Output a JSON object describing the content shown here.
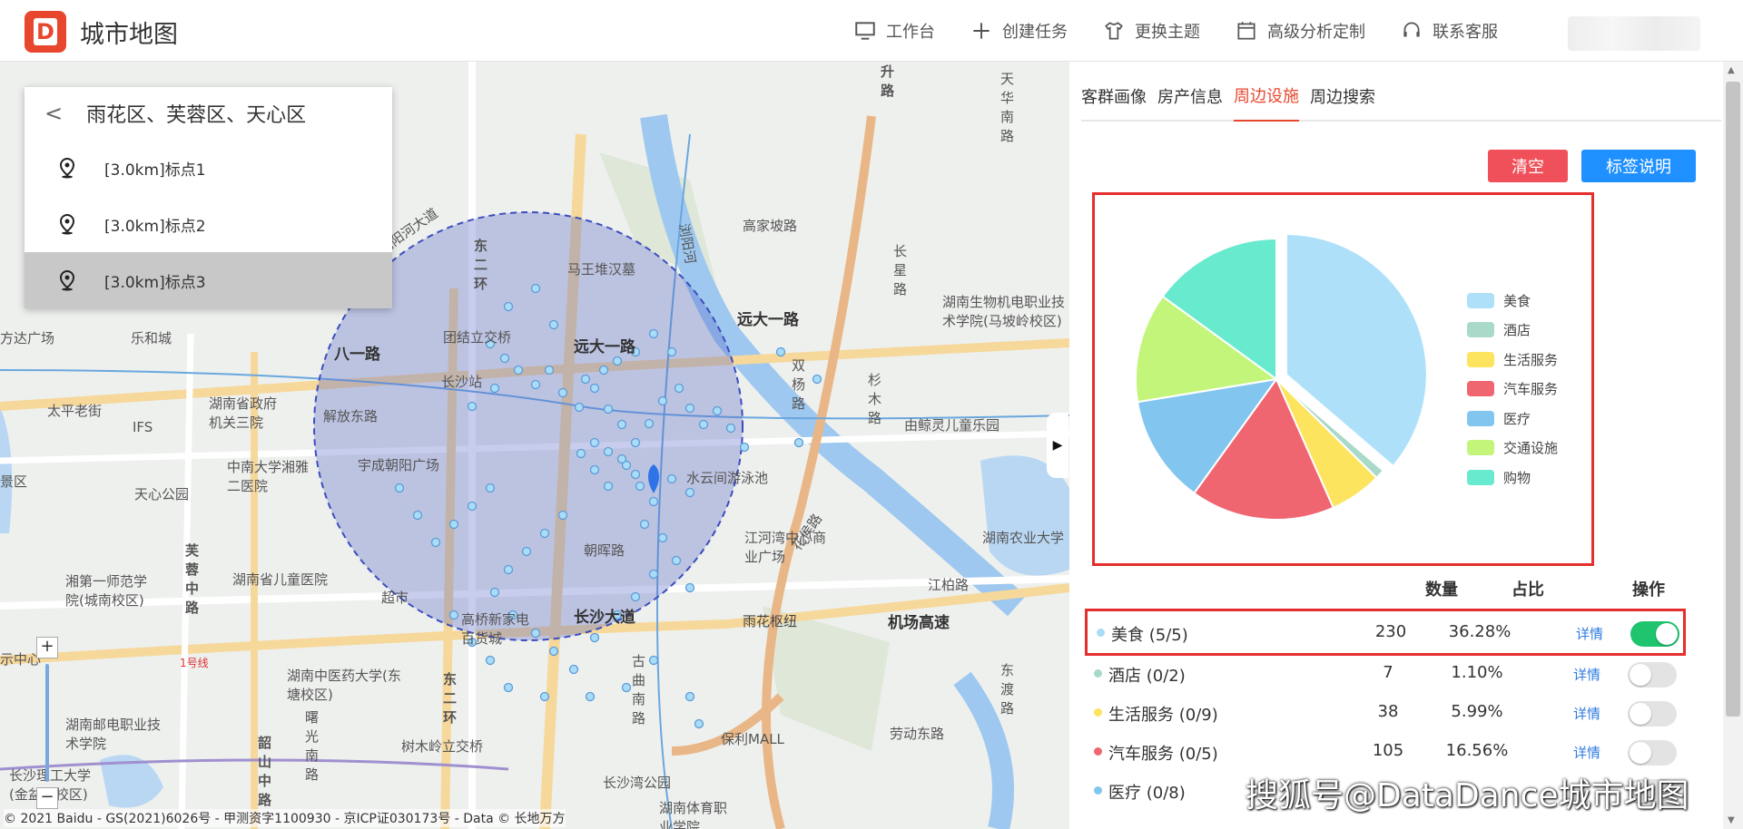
{
  "header": {
    "logo_text": "D",
    "title": "城市地图",
    "nav": [
      {
        "label": "工作台",
        "icon": "monitor-icon"
      },
      {
        "label": "创建任务",
        "icon": "plus-icon"
      },
      {
        "label": "更换主题",
        "icon": "shirt-icon"
      },
      {
        "label": "高级分析定制",
        "icon": "calendar-icon"
      },
      {
        "label": "联系客服",
        "icon": "headset-icon"
      }
    ]
  },
  "location_panel": {
    "title": "雨花区、芙蓉区、天心区",
    "items": [
      {
        "label": "[3.0km]标点1",
        "active": false
      },
      {
        "label": "[3.0km]标点2",
        "active": false
      },
      {
        "label": "[3.0km]标点3",
        "active": true
      }
    ]
  },
  "map": {
    "labels": {
      "l1": "马王堆汉墓",
      "l2": "远大一路",
      "l3": "远大一路",
      "l4": "团结立交桥",
      "l5": "长沙站",
      "l6": "八一路",
      "l7": "湖南省政府机关三院",
      "l8": "解放东路",
      "l9": "太平老街",
      "l10": "IFS",
      "l11": "中南大学湘雅二医院",
      "l12": "天心公园",
      "l13": "宇成朝阳广场",
      "l14": "水云间游泳池",
      "l15": "江河湾中心商业广场",
      "l16": "朝晖路",
      "l17": "长沙大道",
      "l18": "雨花枢纽",
      "l19": "机场高速",
      "l20": "高桥新家电百货城",
      "l21": "湖南省儿童医院",
      "l22": "湖南中医药大学(东塘校区)",
      "l23": "湖南邮电职业技术学院",
      "l24": "长沙理工大学(金盆岭校区)",
      "l25": "湖南生物机电职业技术学院(马坡岭校区)",
      "l26": "由鲸灵儿童乐园",
      "l27": "湖南农业大学",
      "l28": "高家坡路",
      "l29": "湘第一师范学院(城南校区)",
      "l30": "乐和城",
      "l31": "劳动东路",
      "l32": "树木岭立交桥",
      "l33": "保利MALL",
      "l34": "长沙湾公园",
      "l35": "湖南体育职业学院",
      "l36": "浏阳河大道",
      "l37": "东二环",
      "l38": "芙蓉中路",
      "l39": "韶山中路",
      "l40": "双杨路",
      "l41": "杉木路",
      "l42": "花侯路",
      "l43": "古曲南路",
      "l44": "曙光南路",
      "l45": "江柏路",
      "l46": "浏阳河",
      "l47": "超市",
      "l48": "长星路",
      "l49": "天华南路",
      "l50": "景区",
      "l51": "方达广场",
      "l52": "东二环",
      "l53": "1号线",
      "l54": "升路",
      "l55": "东渡路",
      "l56": "示中心",
      "l57": "湖南农业大学"
    },
    "copyright": "© 2021 Baidu - GS(2021)6026号 - 甲测资字1100930 - 京ICP证030173号 - Data © 长地万方"
  },
  "panel": {
    "tabs": [
      {
        "label": "客群画像",
        "active": false
      },
      {
        "label": "房产信息",
        "active": false
      },
      {
        "label": "周边设施",
        "active": true
      },
      {
        "label": "周边搜索",
        "active": false
      }
    ],
    "clear_label": "清空",
    "legend_label": "标签说明",
    "table_headers": {
      "count": "数量",
      "ratio": "占比",
      "action": "操作"
    },
    "rows": [
      {
        "name": "美食 (5/5)",
        "count": "230",
        "ratio": "36.28%",
        "link": "详情",
        "on": true,
        "color": "#a8dcf7"
      },
      {
        "name": "酒店 (0/2)",
        "count": "7",
        "ratio": "1.10%",
        "link": "详情",
        "on": false,
        "color": "#a7d8c9"
      },
      {
        "name": "生活服务 (0/9)",
        "count": "38",
        "ratio": "5.99%",
        "link": "详情",
        "on": false,
        "color": "#fde45e"
      },
      {
        "name": "汽车服务 (0/5)",
        "count": "105",
        "ratio": "16.56%",
        "link": "详情",
        "on": false,
        "color": "#ef6570"
      },
      {
        "name": "医疗 (0/8)",
        "count": "",
        "ratio": "",
        "link": "",
        "on": false,
        "color": "#82c6ef"
      }
    ]
  },
  "chart_data": {
    "type": "pie",
    "categories": [
      "美食",
      "酒店",
      "生活服务",
      "汽车服务",
      "医疗",
      "交通设施",
      "购物"
    ],
    "values": [
      230,
      7,
      38,
      105,
      79,
      80,
      95
    ],
    "colors": [
      "#aee1f9",
      "#a9d9c8",
      "#fde45e",
      "#ef6570",
      "#82c6ef",
      "#c3f57a",
      "#68eacf"
    ],
    "exploded": "美食",
    "legend_position": "right"
  },
  "watermark": "搜狐号@DataDance城市地图"
}
